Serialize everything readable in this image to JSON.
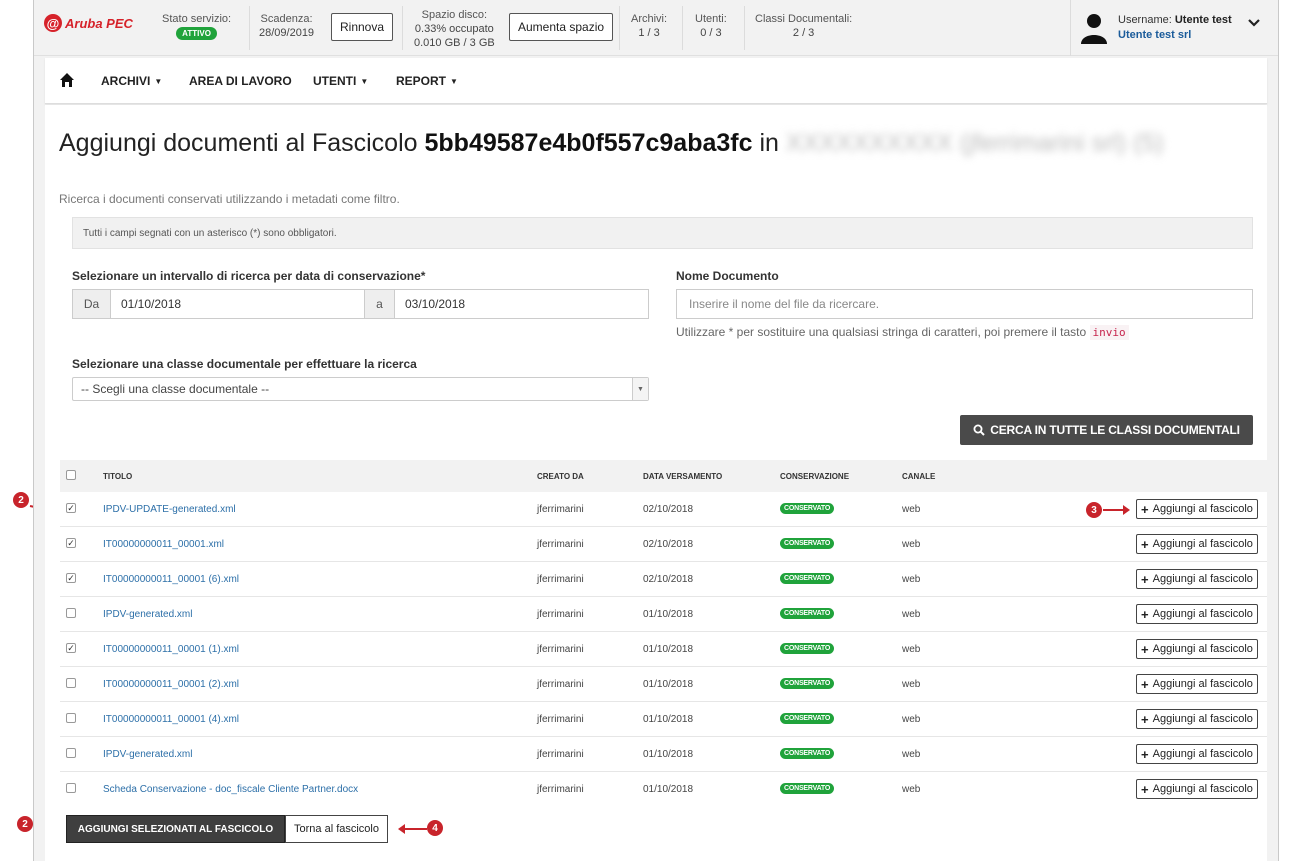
{
  "brand": {
    "logo_text": "Aruba PEC"
  },
  "topbar": {
    "service_label": "Stato servizio:",
    "service_status": "ATTIVO",
    "expiry_label": "Scadenza:",
    "expiry_value": "28/09/2019",
    "renew_label": "Rinnova",
    "disk_label": "Spazio disco:",
    "disk_percent": "0.33% occupato",
    "disk_usage": "0.010 GB / 3 GB",
    "increase_label": "Aumenta spazio",
    "archives_label": "Archivi:",
    "archives_value": "1 / 3",
    "users_label": "Utenti:",
    "users_value": "0 / 3",
    "classes_label": "Classi Documentali:",
    "classes_value": "2 / 3",
    "username_label": "Username:",
    "username_value": "Utente test",
    "org_value": "Utente test srl"
  },
  "nav": {
    "items": [
      {
        "label": "ARCHIVI",
        "has_caret": true
      },
      {
        "label": "AREA DI LAVORO",
        "has_caret": false
      },
      {
        "label": "UTENTI",
        "has_caret": true
      },
      {
        "label": "REPORT",
        "has_caret": true
      }
    ]
  },
  "page": {
    "title_prefix": "Aggiungi documenti al Fascicolo",
    "title_id": "5bb49587e4b0f557c9aba3fc",
    "title_in": "in",
    "title_blurred": "XXXXXXXXXX (jferrimarini srl) (5)",
    "intro": "Ricerca i documenti conservati utilizzando i metadati come filtro.",
    "notice": "Tutti i campi segnati con un asterisco (*) sono obbligatori."
  },
  "form": {
    "date_range_label": "Selezionare un intervallo di ricerca per data di conservazione*",
    "from_addon": "Da",
    "from_value": "01/10/2018",
    "to_addon": "a",
    "to_value": "03/10/2018",
    "doc_name_label": "Nome Documento",
    "doc_name_placeholder": "Inserire il nome del file da ricercare.",
    "hint_before": "Utilizzare  *  per sostituire una qualsiasi stringa di caratteri, poi premere il tasto",
    "hint_key": "invio",
    "class_label": "Selezionare una classe documentale per effettuare la ricerca",
    "class_selected": "-- Scegli una classe documentale --",
    "search_all_label": "CERCA IN TUTTE LE CLASSI DOCUMENTALI"
  },
  "table": {
    "headers": {
      "title": "TITOLO",
      "created_by": "CREATO DA",
      "date": "DATA VERSAMENTO",
      "conservation": "CONSERVAZIONE",
      "channel": "CANALE"
    },
    "add_label": "Aggiungi al fascicolo",
    "rows": [
      {
        "checked": true,
        "title": "IPDV-UPDATE-generated.xml",
        "created_by": "jferrimarini",
        "date": "02/10/2018",
        "status": "CONSERVATO",
        "channel": "web"
      },
      {
        "checked": true,
        "title": "IT00000000011_00001.xml",
        "created_by": "jferrimarini",
        "date": "02/10/2018",
        "status": "CONSERVATO",
        "channel": "web"
      },
      {
        "checked": true,
        "title": "IT00000000011_00001 (6).xml",
        "created_by": "jferrimarini",
        "date": "02/10/2018",
        "status": "CONSERVATO",
        "channel": "web"
      },
      {
        "checked": false,
        "title": "IPDV-generated.xml",
        "created_by": "jferrimarini",
        "date": "01/10/2018",
        "status": "CONSERVATO",
        "channel": "web"
      },
      {
        "checked": true,
        "title": "IT00000000011_00001 (1).xml",
        "created_by": "jferrimarini",
        "date": "01/10/2018",
        "status": "CONSERVATO",
        "channel": "web"
      },
      {
        "checked": false,
        "title": "IT00000000011_00001 (2).xml",
        "created_by": "jferrimarini",
        "date": "01/10/2018",
        "status": "CONSERVATO",
        "channel": "web"
      },
      {
        "checked": false,
        "title": "IT00000000011_00001 (4).xml",
        "created_by": "jferrimarini",
        "date": "01/10/2018",
        "status": "CONSERVATO",
        "channel": "web"
      },
      {
        "checked": false,
        "title": "IPDV-generated.xml",
        "created_by": "jferrimarini",
        "date": "01/10/2018",
        "status": "CONSERVATO",
        "channel": "web"
      },
      {
        "checked": false,
        "title": "Scheda Conservazione - doc_fiscale Cliente Partner.docx",
        "created_by": "jferrimarini",
        "date": "01/10/2018",
        "status": "CONSERVATO",
        "channel": "web"
      }
    ]
  },
  "actions": {
    "add_selected_label": "AGGIUNGI SELEZIONATI AL FASCICOLO",
    "back_label": "Torna al fascicolo"
  },
  "callouts": {
    "select_step": "2",
    "add_step": "3",
    "back_step": "4"
  }
}
